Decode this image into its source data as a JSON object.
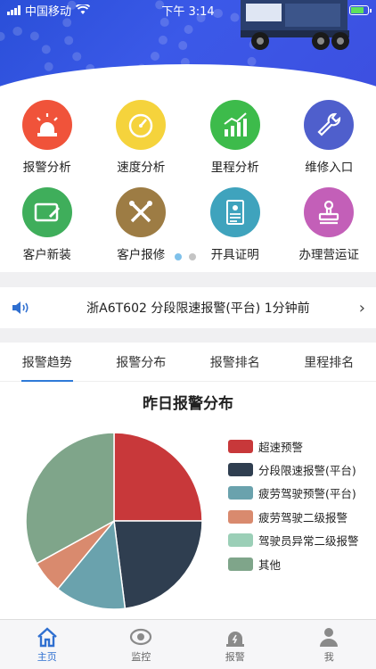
{
  "status": {
    "carrier": "中国移动",
    "time": "下午 3:14"
  },
  "menu": {
    "items": [
      {
        "label": "报警分析",
        "icon": "alarm-light-icon",
        "color": "#f0533a"
      },
      {
        "label": "速度分析",
        "icon": "speedometer-icon",
        "color": "#f5d33c"
      },
      {
        "label": "里程分析",
        "icon": "trend-chart-icon",
        "color": "#3dbb4b"
      },
      {
        "label": "维修入口",
        "icon": "wrench-icon",
        "color": "#4f5fcc"
      },
      {
        "label": "客户新装",
        "icon": "install-card-icon",
        "color": "#3fae5b"
      },
      {
        "label": "客户报修",
        "icon": "tools-icon",
        "color": "#9d7c44"
      },
      {
        "label": "开具证明",
        "icon": "certificate-icon",
        "color": "#3fa3bd"
      },
      {
        "label": "办理营运证",
        "icon": "stamp-icon",
        "color": "#c35fb8"
      }
    ],
    "page_count": 2,
    "active_page": 1
  },
  "notice": {
    "text": "浙A6T602   分段限速报警(平台)   1分钟前"
  },
  "tabs": [
    {
      "label": "报警趋势",
      "active": true
    },
    {
      "label": "报警分布",
      "active": false
    },
    {
      "label": "报警排名",
      "active": false
    },
    {
      "label": "里程排名",
      "active": false
    }
  ],
  "chart_data": {
    "type": "pie",
    "title": "昨日报警分布",
    "legend_position": "right",
    "series": [
      {
        "name": "超速预警",
        "value": 25,
        "color": "#c8383a"
      },
      {
        "name": "分段限速报警(平台)",
        "value": 23,
        "color": "#2f3e50"
      },
      {
        "name": "疲劳驾驶预警(平台)",
        "value": 13,
        "color": "#6aa2ad"
      },
      {
        "name": "疲劳驾驶二级报警",
        "value": 6,
        "color": "#d98a6e"
      },
      {
        "name": "驾驶员异常二级报警",
        "value": 0,
        "color": "#9bcfb7"
      },
      {
        "name": "其他",
        "value": 33,
        "color": "#7fa58a"
      }
    ]
  },
  "tabbar": [
    {
      "label": "主页",
      "icon": "home-icon",
      "active": true
    },
    {
      "label": "监控",
      "icon": "eye-icon",
      "active": false
    },
    {
      "label": "报警",
      "icon": "alarm-icon",
      "active": false
    },
    {
      "label": "我",
      "icon": "person-icon",
      "active": false
    }
  ],
  "colors": {
    "accent": "#2f6fd0",
    "banner": "#3b59e8"
  }
}
